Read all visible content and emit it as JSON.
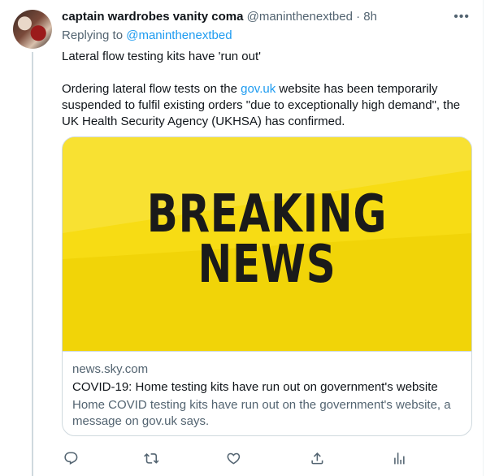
{
  "tweet": {
    "display_name": "captain wardrobes vanity coma",
    "handle": "@maninthenextbed",
    "separator": "·",
    "time": "8h",
    "more_label": "•••",
    "replying_prefix": "Replying to",
    "replying_handle": "@maninthenextbed",
    "body_line1": "Lateral flow testing kits have 'run out'",
    "body_p2_before": "Ordering lateral flow tests on the",
    "body_p2_link": "gov.uk",
    "body_p2_after": "website has been temporarily suspended to fulfil existing orders \"due to exceptionally high demand\", the UK Health Security Agency (UKHSA) has confirmed."
  },
  "card": {
    "image_text_line1": "BREAKING",
    "image_text_line2": "NEWS",
    "domain": "news.sky.com",
    "title": "COVID-19: Home testing kits have run out on government's website",
    "description": "Home COVID testing kits have run out on the government's website, a message on gov.uk says."
  },
  "actions": {
    "icons": [
      "reply-icon",
      "retweet-icon",
      "like-icon",
      "share-icon",
      "analytics-icon"
    ]
  },
  "colors": {
    "accent": "#1d9bf0",
    "card_bg": "#f5d800",
    "muted": "#536471",
    "border": "#cfd9de"
  }
}
